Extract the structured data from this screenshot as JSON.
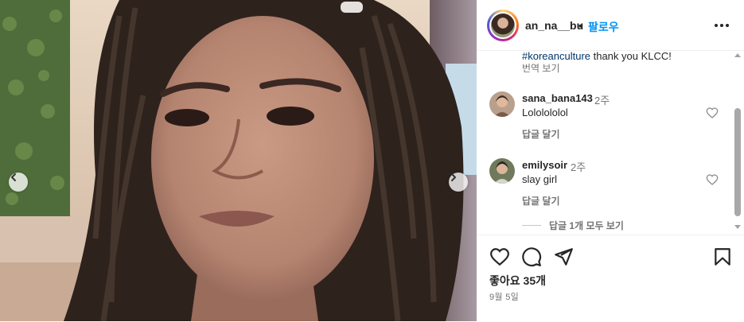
{
  "media": {
    "description_icon": "portrait-photo",
    "prev_icon": "chevron-left-icon",
    "next_icon": "chevron-right-icon"
  },
  "header": {
    "username": "an_na__bu",
    "separator": "•",
    "follow_label": "팔로우",
    "more_icon": "more-horizontal-icon"
  },
  "caption": {
    "hashtag": "#koreanculture",
    "text": " thank you KLCC!",
    "translate_label": "번역 보기"
  },
  "comments": [
    {
      "username": "sana_bana143",
      "time": "2주",
      "text": "Lololololol",
      "reply_label": "답글 달기"
    },
    {
      "username": "emilysoir",
      "time": "2주",
      "text": "slay girl",
      "reply_label": "답글 달기"
    }
  ],
  "view_replies_label": "답글 1개 모두 보기",
  "actions": {
    "like_icon": "heart-icon",
    "comment_icon": "comment-icon",
    "share_icon": "send-icon",
    "save_icon": "bookmark-icon",
    "likes_text": "좋아요 35개",
    "date_text": "9월 5일"
  },
  "colors": {
    "link_blue": "#0095f6",
    "hashtag_blue": "#00376b",
    "secondary_text": "#737373",
    "primary_text": "#262626"
  }
}
